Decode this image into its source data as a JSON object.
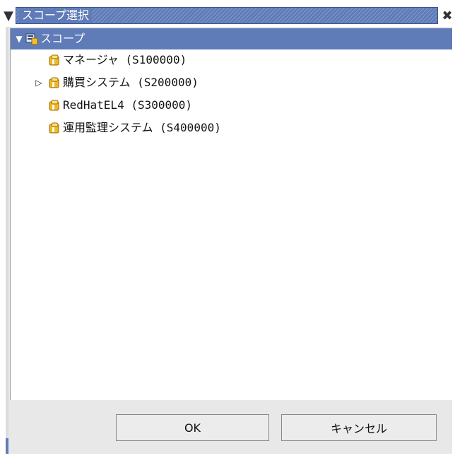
{
  "window": {
    "title": "スコープ選択",
    "menu_icon": "chevron-down-icon",
    "close_icon": "close-icon"
  },
  "tree": {
    "root": {
      "label": "スコープ",
      "expanded": true,
      "icon": "scope-root-icon"
    },
    "children": [
      {
        "label": "マネージャ (S100000)",
        "expandable": false,
        "icon": "scope-folder-icon"
      },
      {
        "label": "購買システム (S200000)",
        "expandable": true,
        "expanded": false,
        "icon": "scope-folder-icon"
      },
      {
        "label": "RedHatEL4 (S300000)",
        "expandable": false,
        "icon": "scope-folder-icon"
      },
      {
        "label": "運用監理システム (S400000)",
        "expandable": false,
        "icon": "scope-folder-icon"
      }
    ]
  },
  "buttons": {
    "ok_label": "OK",
    "cancel_label": "キャンセル"
  },
  "colors": {
    "selection": "#5f7bb8",
    "folder_icon": "#e6b020"
  }
}
